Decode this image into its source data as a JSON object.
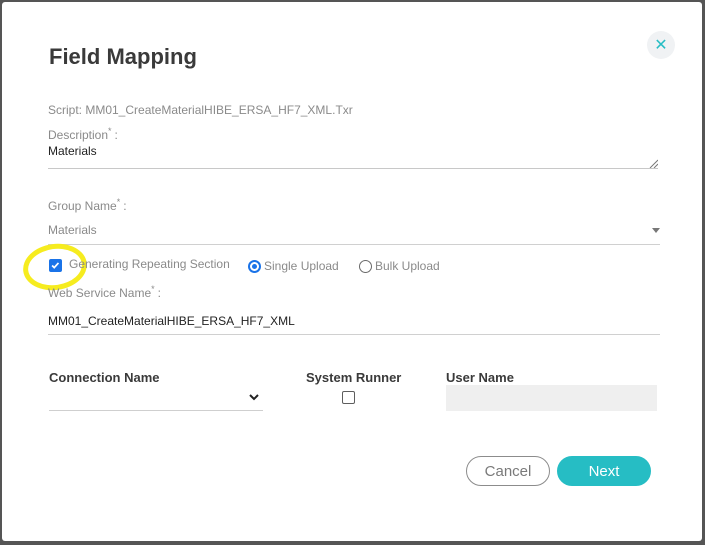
{
  "dialog": {
    "title": "Field Mapping",
    "close_symbol": "✕"
  },
  "script": {
    "text": "Script: MM01_CreateMaterialHIBE_ERSA_HF7_XML.Txr"
  },
  "description": {
    "label": "Description",
    "required_mark": "*",
    "colon": ":",
    "value": "Materials"
  },
  "group": {
    "label": "Group Name",
    "required_mark": "*",
    "colon": ":",
    "value": "Materials"
  },
  "options": {
    "repeating_label": "Generating Repeating Section",
    "repeating_checked": true,
    "single_upload_label": "Single Upload",
    "bulk_upload_label": "Bulk Upload",
    "selected_upload": "single"
  },
  "web_service": {
    "label": "Web Service Name",
    "required_mark": "*",
    "colon": ":",
    "value": "MM01_CreateMaterialHIBE_ERSA_HF7_XML"
  },
  "connection": {
    "connection_header": "Connection Name",
    "system_runner_header": "System Runner",
    "user_name_header": "User Name",
    "connection_value": "",
    "system_runner_checked": false,
    "user_name_value": ""
  },
  "footer": {
    "cancel_label": "Cancel",
    "next_label": "Next"
  },
  "colors": {
    "accent": "#26bdc4",
    "checkbox": "#1a73e8",
    "highlight": "#f6ec1f"
  }
}
